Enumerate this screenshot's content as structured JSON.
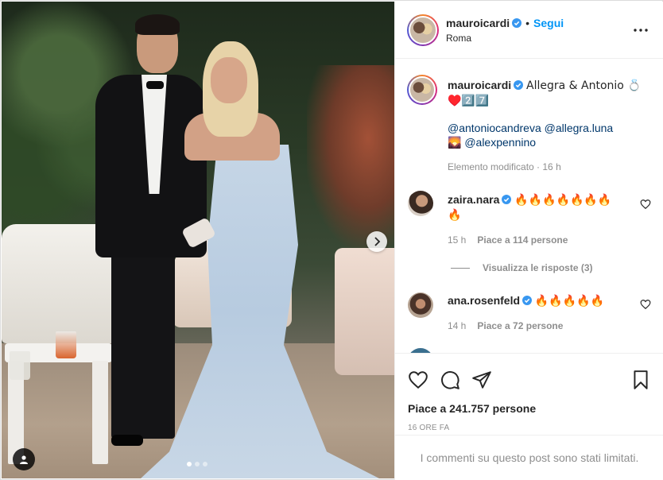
{
  "post": {
    "username": "mauroicardi",
    "follow_label": "Segui",
    "separator": "•",
    "location": "Roma"
  },
  "caption": {
    "username": "mauroicardi",
    "text_line1": "Allegra & Antonio 💍",
    "text_line2": "♥️2️⃣7️⃣",
    "mentions_line1": "@antoniocandreva @allegra.luna",
    "mentions_line2_icon": "🌄",
    "mentions_line2": "@alexpennino",
    "edited": "Elemento modificato · 16 h"
  },
  "comments": [
    {
      "username": "zaira.nara",
      "text": "🔥🔥🔥🔥🔥🔥🔥",
      "text_line2": "🔥",
      "time": "15 h",
      "likes": "Piace a 114 persone"
    },
    {
      "username": "ana.rosenfeld",
      "text": "🔥🔥🔥🔥🔥",
      "time": "14 h",
      "likes": "Piace a 72 persone"
    }
  ],
  "replies_label": "Visualizza le risposte (3)",
  "likes_count": "Piace a 241.757 persone",
  "timestamp": "16 ORE FA",
  "comments_limited": "I commenti su questo post sono stati limitati.",
  "icons": {
    "verified": "verified-badge-icon",
    "more": "more-options-icon",
    "heart": "heart-icon",
    "comment": "comment-icon",
    "share": "share-icon",
    "save": "bookmark-icon",
    "next": "chevron-right-icon",
    "tag": "user-tag-icon"
  },
  "colors": {
    "link": "#0095f6",
    "verified": "#3897f0",
    "muted": "#8e8e8e",
    "text": "#262626"
  },
  "carousel": {
    "current": 1,
    "total": 3
  }
}
